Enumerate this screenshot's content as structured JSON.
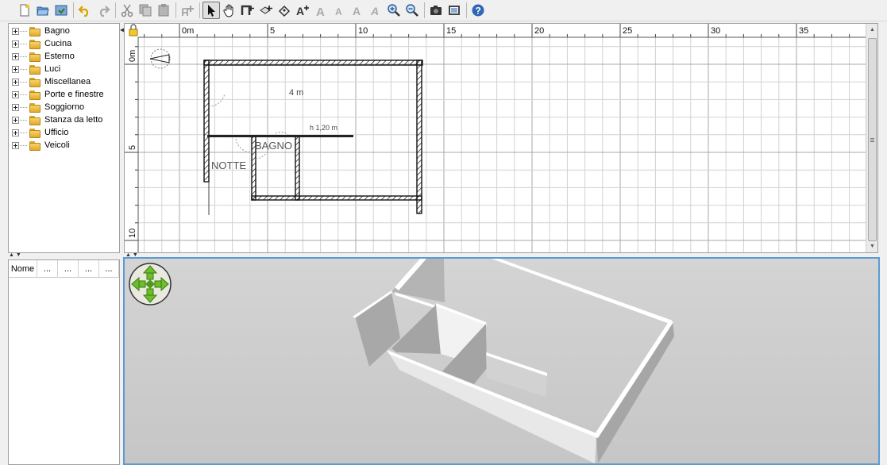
{
  "toolbar": {
    "buttons": [
      {
        "icon": "new-home-icon"
      },
      {
        "icon": "open-icon"
      },
      {
        "icon": "save-icon"
      },
      {
        "icon": "undo-icon"
      },
      {
        "icon": "redo-icon"
      },
      {
        "icon": "cut-icon"
      },
      {
        "icon": "copy-icon"
      },
      {
        "icon": "paste-icon"
      },
      {
        "icon": "add-furniture-icon"
      },
      {
        "icon": "select-icon"
      },
      {
        "icon": "pan-icon"
      },
      {
        "icon": "create-walls-icon"
      },
      {
        "icon": "create-rooms-icon"
      },
      {
        "icon": "create-dimensions-icon"
      },
      {
        "icon": "add-text-icon"
      },
      {
        "icon": "increase-text-size-icon"
      },
      {
        "icon": "decrease-text-size-icon"
      },
      {
        "icon": "bold-text-icon"
      },
      {
        "icon": "italic-text-icon"
      },
      {
        "icon": "zoom-in-icon"
      },
      {
        "icon": "zoom-out-icon"
      },
      {
        "icon": "create-photo-icon"
      },
      {
        "icon": "create-video-icon"
      },
      {
        "icon": "help-icon"
      }
    ]
  },
  "catalog": {
    "categories": [
      "Bagno",
      "Cucina",
      "Esterno",
      "Luci",
      "Miscellanea",
      "Porte e finestre",
      "Soggiorno",
      "Stanza da letto",
      "Ufficio",
      "Veicoli"
    ]
  },
  "furniture_table": {
    "columns": [
      "Nome",
      "...",
      "...",
      "...",
      "..."
    ]
  },
  "plan": {
    "ruler_x_labels": [
      "0m",
      "5",
      "10",
      "15",
      "20",
      "25",
      "30",
      "35"
    ],
    "ruler_y_labels": [
      "0m",
      "5",
      "10"
    ],
    "dimension_label": "4 m",
    "wall_height_label": "h 1,20 m",
    "room_labels": [
      "BAGNO",
      "NOTTE"
    ]
  }
}
